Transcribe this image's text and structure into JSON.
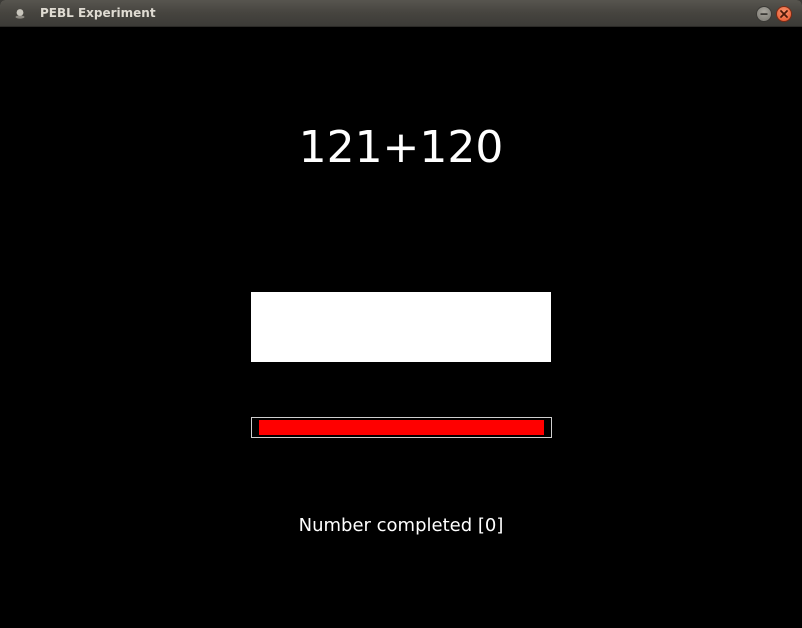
{
  "window": {
    "title": "PEBL Experiment"
  },
  "task": {
    "problem": "121+120",
    "answer_value": "",
    "timer_remaining_fraction": 0.96,
    "timer_color": "#ff0000",
    "completed_label": "Number completed",
    "completed_count": "[0]"
  },
  "colors": {
    "background": "#000000",
    "text": "#ffffff",
    "answer_box": "#ffffff"
  },
  "icons": {
    "app": "app-icon",
    "minimize": "minimize-icon",
    "close": "close-icon"
  }
}
